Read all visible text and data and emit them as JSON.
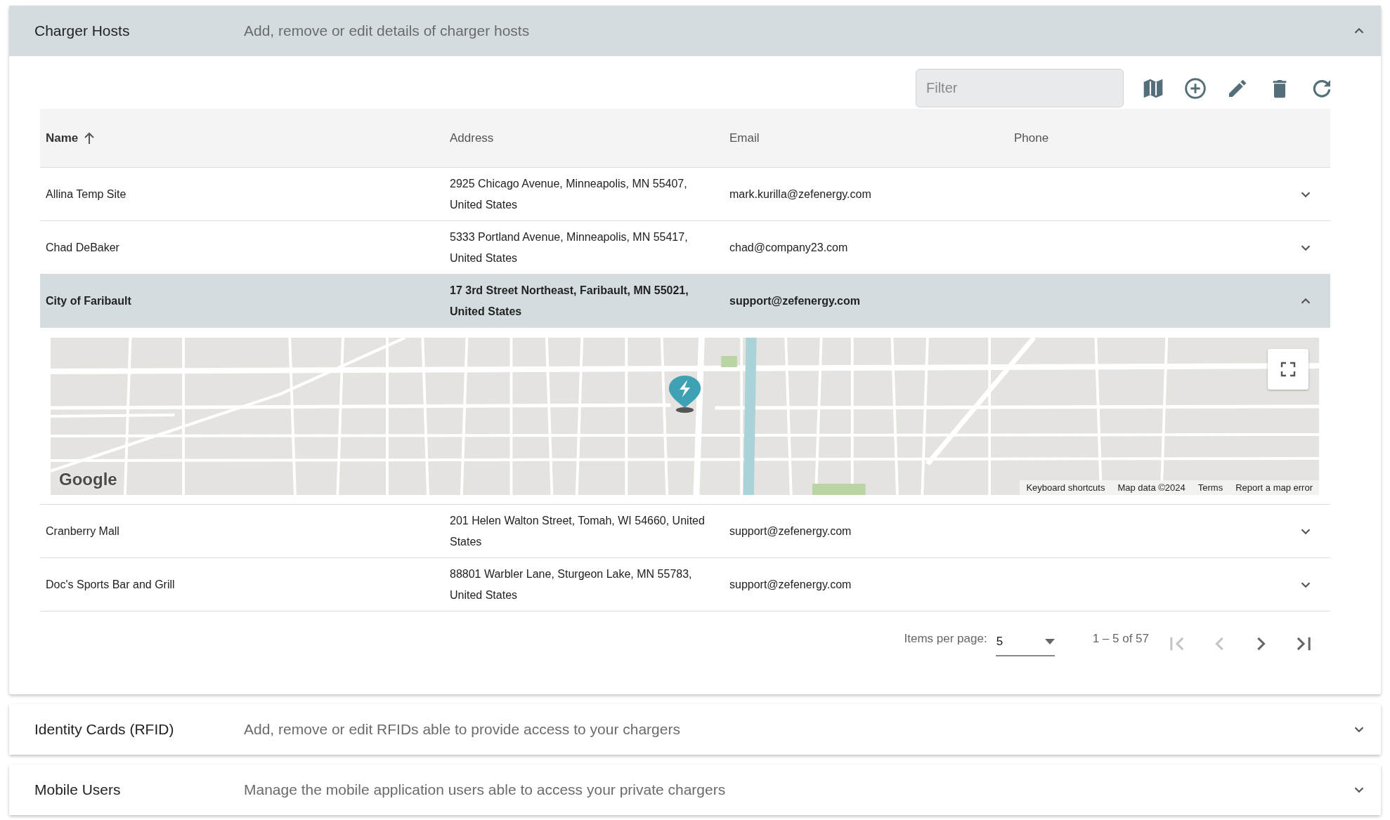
{
  "panels": [
    {
      "title": "Charger Hosts",
      "description": "Add, remove or edit details of charger hosts",
      "expanded": true
    },
    {
      "title": "Identity Cards (RFID)",
      "description": "Add, remove or edit RFIDs able to provide access to your chargers",
      "expanded": false
    },
    {
      "title": "Mobile Users",
      "description": "Manage the mobile application users able to access your private chargers",
      "expanded": false
    }
  ],
  "toolbar": {
    "filter": {
      "placeholder": "Filter"
    },
    "actions": [
      {
        "kind": "map"
      },
      {
        "kind": "add"
      },
      {
        "kind": "edit"
      },
      {
        "kind": "delete"
      },
      {
        "kind": "refresh"
      }
    ]
  },
  "table": {
    "columns": [
      {
        "label": "Name",
        "sorted": true
      },
      {
        "label": "Address",
        "sorted": false
      },
      {
        "label": "Email",
        "sorted": false
      },
      {
        "label": "Phone",
        "sorted": false
      }
    ],
    "rows": [
      {
        "name": "Allina Temp Site",
        "address": "2925 Chicago Avenue, Minneapolis, MN 55407, United States",
        "email": "mark.kurilla@zefenergy.com",
        "expanded": false
      },
      {
        "name": "Chad DeBaker",
        "address": "5333 Portland Avenue, Minneapolis, MN 55417, United States",
        "email": "chad@company23.com",
        "expanded": false
      },
      {
        "name": "City of Faribault",
        "address": "17 3rd Street Northeast, Faribault, MN 55021, United States",
        "email": "support@zefenergy.com",
        "expanded": true
      },
      {
        "name": "Cranberry Mall",
        "address": "201 Helen Walton Street, Tomah, WI 54660, United States",
        "email": "support@zefenergy.com",
        "expanded": false
      },
      {
        "name": "Doc's Sports Bar and Grill",
        "address": "88801 Warbler Lane, Sturgeon Lake, MN 55783, United States",
        "email": "support@zefenergy.com",
        "expanded": false
      }
    ]
  },
  "map": {
    "logo": "Google",
    "footer": [
      "Keyboard shortcuts",
      "Map data ©2024",
      "Terms",
      "Report a map error"
    ]
  },
  "paginator": {
    "label": "Items per page:",
    "page_size": "5",
    "range": "1 – 5 of 57",
    "buttons": [
      {
        "kind": "first",
        "disabled": true
      },
      {
        "kind": "previous",
        "disabled": true
      },
      {
        "kind": "next",
        "disabled": false
      },
      {
        "kind": "last",
        "disabled": false
      }
    ]
  }
}
